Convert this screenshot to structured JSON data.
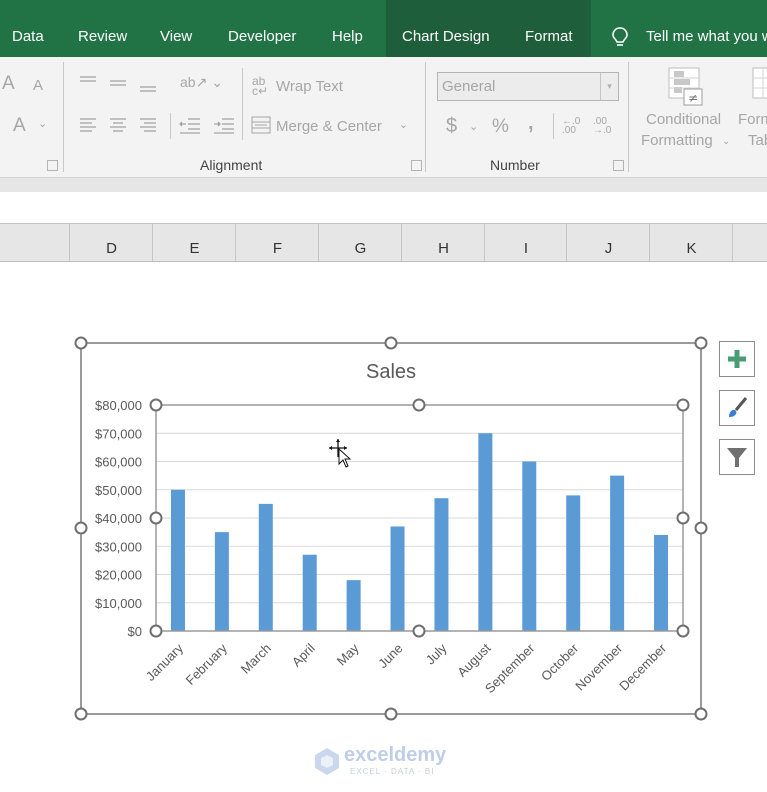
{
  "ribbon_tabs": {
    "data": "Data",
    "review": "Review",
    "view": "View",
    "developer": "Developer",
    "help": "Help",
    "chart_design": "Chart Design",
    "format": "Format",
    "tell_me": "Tell me what you want to do"
  },
  "ribbon": {
    "wrap_text": "Wrap Text",
    "merge_center": "Merge & Center",
    "alignment_group": "Alignment",
    "number_format_value": "General",
    "number_group": "Number",
    "currency_symbol": "$",
    "percent_symbol": "%",
    "comma_symbol": ",",
    "conditional_formatting_line1": "Conditional",
    "conditional_formatting_line2": "Formatting",
    "format_as_table_line1": "Format as",
    "format_as_table_line2": "Table",
    "font_grow": "A",
    "font_shrink": "A",
    "font_color": "A"
  },
  "columns": [
    "D",
    "E",
    "F",
    "G",
    "H",
    "I",
    "J",
    "K"
  ],
  "chart_buttons": {
    "elements": "plus-icon",
    "styles": "brush-icon",
    "filters": "filter-icon"
  },
  "watermark": {
    "name": "exceldemy",
    "tagline": "EXCEL · DATA · BI"
  },
  "colors": {
    "excel_green": "#217346",
    "context_tab": "#1e5e3a",
    "bar": "#5b9bd5"
  },
  "chart_data": {
    "type": "bar",
    "title": "Sales",
    "xlabel": "",
    "ylabel": "",
    "categories": [
      "January",
      "February",
      "March",
      "April",
      "May",
      "June",
      "July",
      "August",
      "September",
      "October",
      "November",
      "December"
    ],
    "values": [
      50000,
      35000,
      45000,
      27000,
      18000,
      37000,
      47000,
      70000,
      60000,
      48000,
      55000,
      34000
    ],
    "ylim": [
      0,
      80000
    ],
    "yticks": [
      0,
      10000,
      20000,
      30000,
      40000,
      50000,
      60000,
      70000,
      80000
    ],
    "ytick_labels": [
      "$0",
      "$10,000",
      "$20,000",
      "$30,000",
      "$40,000",
      "$50,000",
      "$60,000",
      "$70,000",
      "$80,000"
    ],
    "grid": true,
    "legend": "none"
  }
}
